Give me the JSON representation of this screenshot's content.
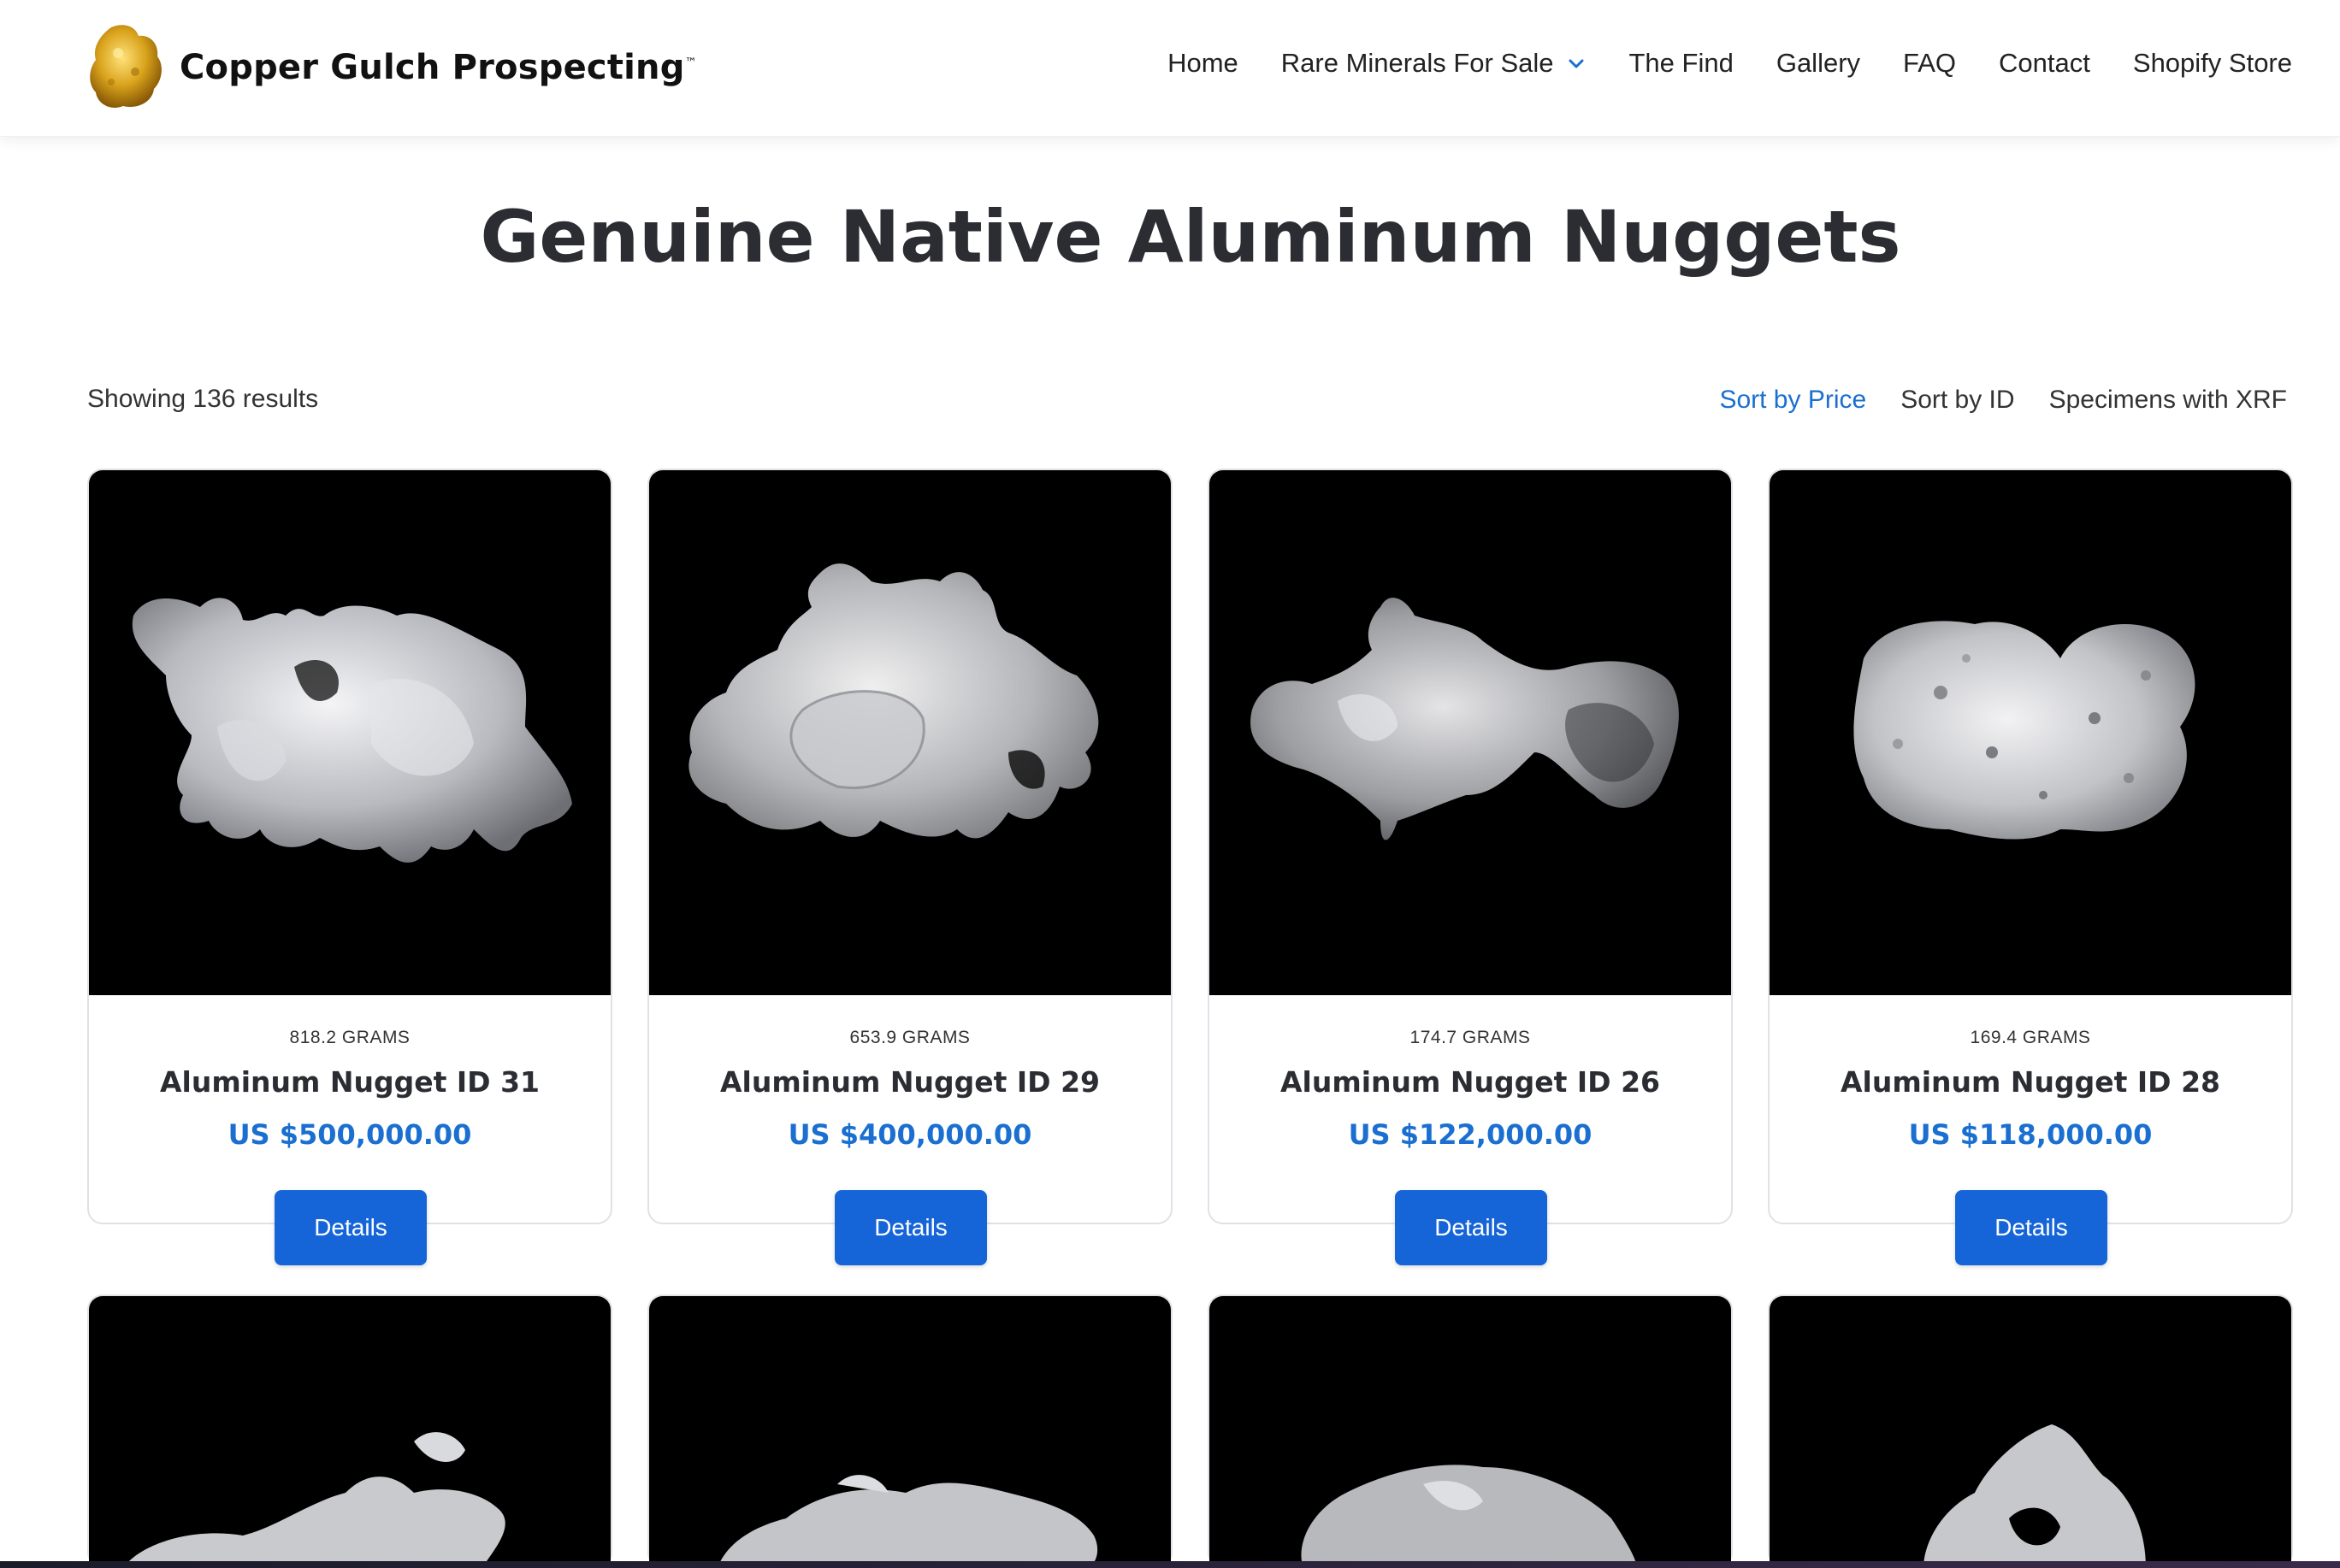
{
  "header": {
    "brand": "Copper Gulch Prospecting",
    "brand_mark": "™",
    "logo_icon": "gold-nugget-logo",
    "nav": [
      {
        "label": "Home"
      },
      {
        "label": "Rare Minerals For Sale",
        "icon": "chevron-down-icon"
      },
      {
        "label": "The Find"
      },
      {
        "label": "Gallery"
      },
      {
        "label": "FAQ"
      },
      {
        "label": "Contact"
      },
      {
        "label": "Shopify Store"
      }
    ]
  },
  "page": {
    "title": "Genuine Native Aluminum Nuggets",
    "results_text": "Showing 136 results",
    "sort_options": [
      "Sort by Price",
      "Sort by ID",
      "Specimens with XRF"
    ],
    "active_sort": "Sort by Price"
  },
  "products": [
    {
      "weight": "818.2 GRAMS",
      "name": "Aluminum Nugget ID 31",
      "price": "US $500,000.00",
      "button": "Details"
    },
    {
      "weight": "653.9 GRAMS",
      "name": "Aluminum Nugget ID 29",
      "price": "US $400,000.00",
      "button": "Details"
    },
    {
      "weight": "174.7 GRAMS",
      "name": "Aluminum Nugget ID 26",
      "price": "US $122,000.00",
      "button": "Details"
    },
    {
      "weight": "169.4 GRAMS",
      "name": "Aluminum Nugget ID 28",
      "price": "US $118,000.00",
      "button": "Details"
    }
  ],
  "colors": {
    "accent": "#1a6fd0",
    "button": "#1565d8",
    "title": "#2b2d33",
    "image_bg": "#000000"
  }
}
